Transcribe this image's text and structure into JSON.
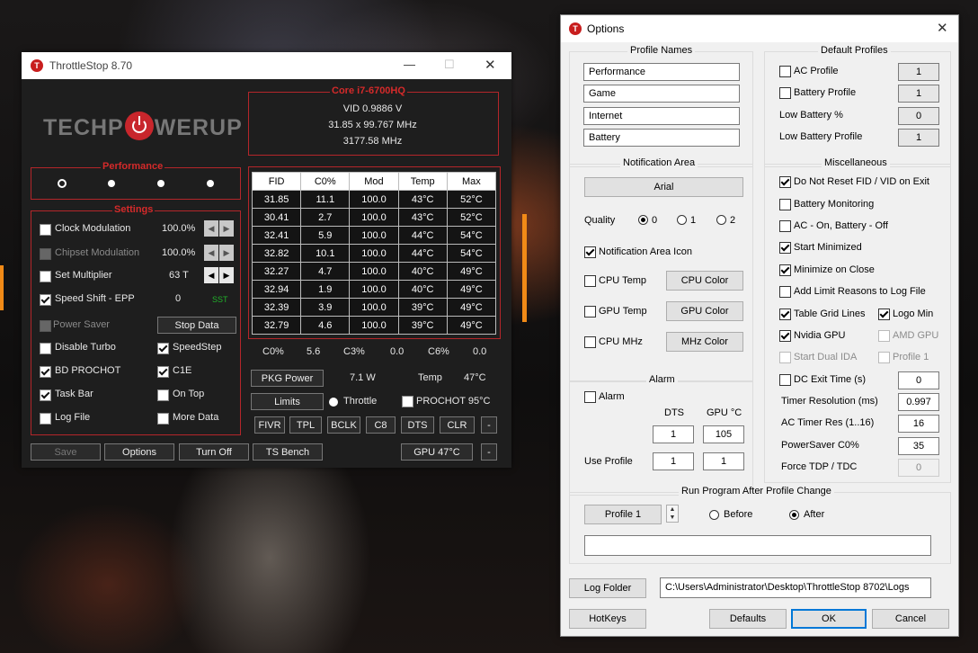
{
  "ts": {
    "title": "ThrottleStop 8.70",
    "logo_left": "TECHP",
    "logo_right": "WERUP",
    "cpu_name": "Core i7-6700HQ",
    "vid": "VID  0.9886 V",
    "mult": "31.85 x 99.767 MHz",
    "freq": "3177.58 MHz",
    "performance_label": "Performance",
    "settings_label": "Settings",
    "clock_mod": "Clock Modulation",
    "clock_mod_val": "100.0%",
    "chipset_mod": "Chipset Modulation",
    "chipset_mod_val": "100.0%",
    "set_mult": "Set Multiplier",
    "set_mult_val": "63 T",
    "speed_shift": "Speed Shift - EPP",
    "speed_shift_val": "0",
    "sst": "SST",
    "power_saver": "Power Saver",
    "stop_data": "Stop Data",
    "disable_turbo": "Disable Turbo",
    "speedstep": "SpeedStep",
    "bd_prochot": "BD PROCHOT",
    "c1e": "C1E",
    "task_bar": "Task Bar",
    "on_top": "On Top",
    "log_file": "Log File",
    "more_data": "More Data",
    "btn_save": "Save",
    "btn_options": "Options",
    "btn_turn_off": "Turn Off",
    "btn_ts_bench": "TS Bench",
    "btn_gpu": "GPU 47°C",
    "btn_dash": "-",
    "table_headers": [
      "FID",
      "C0%",
      "Mod",
      "Temp",
      "Max"
    ],
    "table_rows": [
      [
        "31.85",
        "11.1",
        "100.0",
        "43°C",
        "52°C"
      ],
      [
        "30.41",
        "2.7",
        "100.0",
        "43°C",
        "52°C"
      ],
      [
        "32.41",
        "5.9",
        "100.0",
        "44°C",
        "54°C"
      ],
      [
        "32.82",
        "10.1",
        "100.0",
        "44°C",
        "54°C"
      ],
      [
        "32.27",
        "4.7",
        "100.0",
        "40°C",
        "49°C"
      ],
      [
        "32.94",
        "1.9",
        "100.0",
        "40°C",
        "49°C"
      ],
      [
        "32.39",
        "3.9",
        "100.0",
        "39°C",
        "49°C"
      ],
      [
        "32.79",
        "4.6",
        "100.0",
        "39°C",
        "49°C"
      ]
    ],
    "c0_label": "C0%",
    "c0_val": "5.6",
    "c3_label": "C3%",
    "c3_val": "0.0",
    "c6_label": "C6%",
    "c6_val": "0.0",
    "pkg_power": "PKG Power",
    "pkg_val": "7.1 W",
    "temp_label": "Temp",
    "temp_val": "47°C",
    "limits": "Limits",
    "throttle": "Throttle",
    "prochot": "PROCHOT 95°C",
    "bottom_btns": [
      "FIVR",
      "TPL",
      "BCLK",
      "C8",
      "DTS",
      "CLR",
      "-"
    ]
  },
  "op": {
    "title": "Options",
    "profile_names_label": "Profile Names",
    "profile_names": [
      "Performance",
      "Game",
      "Internet",
      "Battery"
    ],
    "default_profiles_label": "Default Profiles",
    "ac_profile": "AC Profile",
    "ac_profile_val": "1",
    "battery_profile": "Battery Profile",
    "battery_profile_val": "1",
    "low_battery_pct": "Low Battery %",
    "low_battery_pct_val": "0",
    "low_battery_profile": "Low Battery Profile",
    "low_battery_profile_val": "1",
    "notification_label": "Notification Area",
    "font_btn": "Arial",
    "quality": "Quality",
    "q0": "0",
    "q1": "1",
    "q2": "2",
    "notif_icon": "Notification Area Icon",
    "cpu_temp": "CPU Temp",
    "cpu_color": "CPU Color",
    "gpu_temp": "GPU Temp",
    "gpu_color": "GPU Color",
    "cpu_mhz": "CPU MHz",
    "mhz_color": "MHz Color",
    "alarm_group": "Alarm",
    "alarm": "Alarm",
    "dts": "DTS",
    "gpu_c": "GPU °C",
    "alarm_dts_val": "1",
    "alarm_gpu_val": "105",
    "use_profile": "Use Profile",
    "use_profile_dts": "1",
    "use_profile_gpu": "1",
    "misc_label": "Miscellaneous",
    "no_reset": "Do Not Reset FID / VID on Exit",
    "battery_monitoring": "Battery Monitoring",
    "ac_on_batt_off": "AC - On, Battery - Off",
    "start_minimized": "Start Minimized",
    "minimize_close": "Minimize on Close",
    "add_limit": "Add Limit Reasons to Log File",
    "table_grid": "Table Grid Lines",
    "logo_min": "Logo Min",
    "nvidia_gpu": "Nvidia GPU",
    "amd_gpu": "AMD GPU",
    "start_dual": "Start Dual IDA",
    "profile1_cb": "Profile 1",
    "dc_exit": "DC Exit Time (s)",
    "dc_exit_val": "0",
    "timer_res": "Timer Resolution (ms)",
    "timer_res_val": "0.997",
    "ac_timer": "AC Timer Res (1..16)",
    "ac_timer_val": "16",
    "powersaver": "PowerSaver C0%",
    "powersaver_val": "35",
    "force_tdp": "Force TDP / TDC",
    "force_tdp_val": "0",
    "run_program_label": "Run Program After Profile Change",
    "profile1_btn": "Profile 1",
    "before": "Before",
    "after": "After",
    "run_path": "",
    "log_folder": "Log Folder",
    "log_path": "C:\\Users\\Administrator\\Desktop\\ThrottleStop 8702\\Logs",
    "hotkeys": "HotKeys",
    "defaults": "Defaults",
    "ok": "OK",
    "cancel": "Cancel"
  }
}
